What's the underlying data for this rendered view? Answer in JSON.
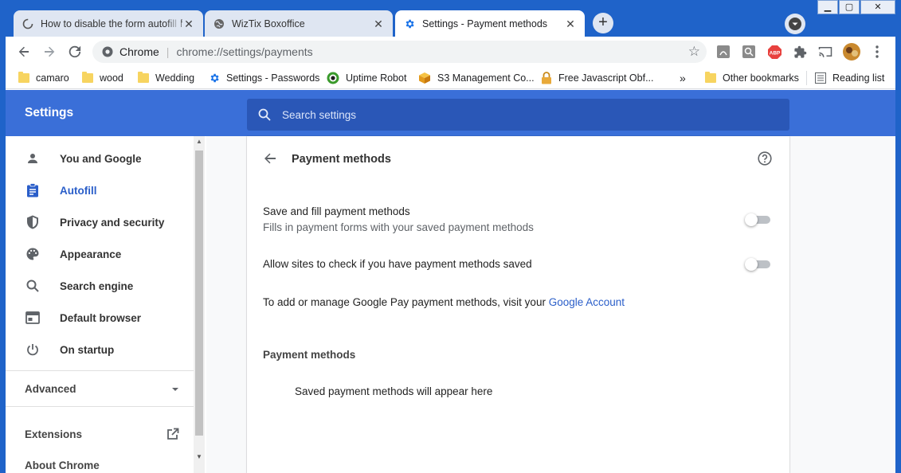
{
  "tabs": [
    {
      "title": "How to disable the form autofill f",
      "close": "✕"
    },
    {
      "title": "WizTix Boxoffice",
      "close": "✕"
    },
    {
      "title": "Settings - Payment methods",
      "close": "✕"
    }
  ],
  "newtab_label": "+",
  "window_controls": {
    "minimize": "▁",
    "maximize": "▢",
    "close": "✕"
  },
  "omnibox": {
    "scheme": "Chrome",
    "separator": "|",
    "url": "chrome://settings/payments"
  },
  "bookmarks": [
    {
      "label": "camaro",
      "icon": "folder-icon"
    },
    {
      "label": "wood",
      "icon": "folder-icon"
    },
    {
      "label": "Wedding",
      "icon": "folder-icon"
    },
    {
      "label": "Settings - Passwords",
      "icon": "gear-icon"
    },
    {
      "label": "Uptime Robot",
      "icon": "uptime-robot-icon"
    },
    {
      "label": "S3 Management Co...",
      "icon": "aws-cube-icon"
    },
    {
      "label": "Free Javascript Obf...",
      "icon": "lock-icon"
    }
  ],
  "bookmarks_overflow": "»",
  "other_bookmarks": "Other bookmarks",
  "reading_list": "Reading list",
  "extensions": {
    "abp": "ABP"
  },
  "settings": {
    "title": "Settings",
    "search_placeholder": "Search settings"
  },
  "sidebar": {
    "items": [
      {
        "label": "You and Google",
        "icon": "person-icon",
        "active": false
      },
      {
        "label": "Autofill",
        "icon": "clipboard-icon",
        "active": true
      },
      {
        "label": "Privacy and security",
        "icon": "shield-icon",
        "active": false
      },
      {
        "label": "Appearance",
        "icon": "palette-icon",
        "active": false
      },
      {
        "label": "Search engine",
        "icon": "search-icon",
        "active": false
      },
      {
        "label": "Default browser",
        "icon": "browser-icon",
        "active": false
      },
      {
        "label": "On startup",
        "icon": "power-icon",
        "active": false
      }
    ],
    "advanced": "Advanced",
    "extensions": "Extensions",
    "about": "About Chrome"
  },
  "page": {
    "title": "Payment methods",
    "save_fill_title": "Save and fill payment methods",
    "save_fill_sub": "Fills in payment forms with your saved payment methods",
    "save_fill_enabled": false,
    "allow_sites_title": "Allow sites to check if you have payment methods saved",
    "allow_sites_enabled": false,
    "gpay_text": "To add or manage Google Pay payment methods, visit your",
    "gpay_link": "Google Account",
    "section_heading": "Payment methods",
    "empty_message": "Saved payment methods will appear here"
  },
  "colors": {
    "accent": "#3a6fd8",
    "link": "#2a5ec9",
    "frame": "#1f63c9"
  }
}
